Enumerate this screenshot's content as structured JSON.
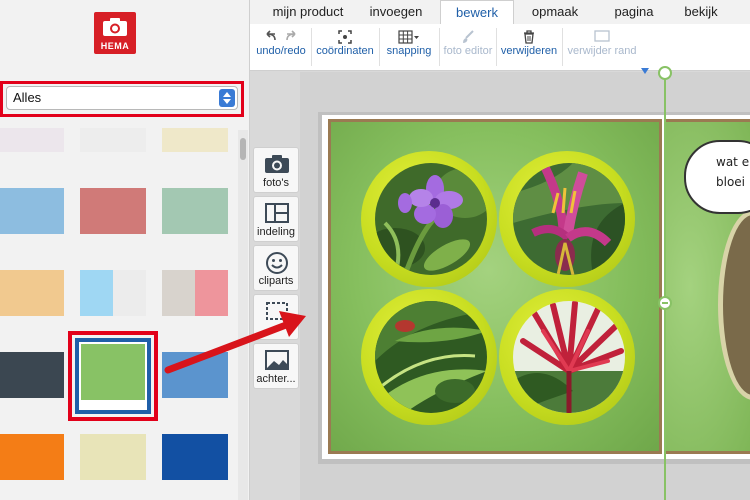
{
  "brand": {
    "logo_text": "HEMA"
  },
  "filter": {
    "selected": "Alles"
  },
  "swatches": [
    {
      "color": "#ece6ec"
    },
    {
      "color": "#ededed"
    },
    {
      "color": "#efe8c9"
    },
    {
      "color": "#8dbde0"
    },
    {
      "color": "#d07a78"
    },
    {
      "color": "#a3c8b2"
    },
    {
      "color": "#f1c98f"
    },
    {
      "colors": [
        "#9fd7f3",
        "#ececec"
      ]
    },
    {
      "colors": [
        "#d8d3cd",
        "#ee959c"
      ]
    },
    {
      "color": "#3b4751"
    },
    {
      "color": "#88c265",
      "selected": true
    },
    {
      "color": "#5b94ce"
    },
    {
      "color": "#f47d16"
    },
    {
      "color": "#e8e4b8"
    },
    {
      "color": "#1250a3"
    }
  ],
  "tabs": [
    {
      "label": "mijn product"
    },
    {
      "label": "invoegen"
    },
    {
      "label": "bewerk",
      "active": true
    },
    {
      "label": "opmaak"
    },
    {
      "label": "pagina"
    },
    {
      "label": "bekijk"
    }
  ],
  "toolbar": {
    "undo_redo": "undo/redo",
    "coordinates": "coördinaten",
    "snapping": "snapping",
    "photo_editor": "foto editor",
    "delete": "verwijderen",
    "remove_border": "verwijder rand"
  },
  "side_tools": {
    "photos": "foto's",
    "layout": "indeling",
    "cliparts": "cliparts",
    "background": "achter..."
  },
  "canvas": {
    "speech_bubble_line1": "wat e",
    "speech_bubble_line2": "bloei"
  },
  "colors": {
    "accent_blue": "#1f5fa8",
    "highlight_red": "#e2001a",
    "selected_swatch": "#88c265",
    "ring_yellow": "#c7dd20"
  }
}
